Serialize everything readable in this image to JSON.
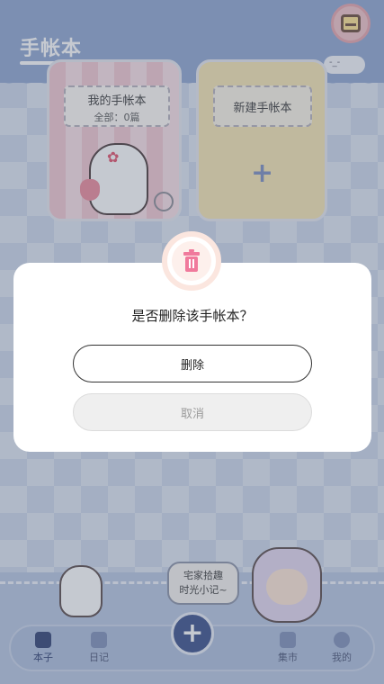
{
  "header": {
    "title": "手帐本"
  },
  "notebooks": [
    {
      "title": "我的手帐本",
      "count_text": "全部：0篇"
    }
  ],
  "new_notebook": {
    "label": "新建手帐本",
    "plus_glyph": "+"
  },
  "dialog": {
    "question": "是否删除该手帐本？",
    "delete_label": "删除",
    "cancel_label": "取消",
    "icon": "trash-icon"
  },
  "decoration": {
    "speech_line1": "宅家拾趣",
    "speech_line2": "时光小记~"
  },
  "tabbar": {
    "items": [
      {
        "label": "本子",
        "icon": "notebook-icon",
        "active": true
      },
      {
        "label": "日记",
        "icon": "calendar-icon",
        "active": false
      },
      {
        "label": "集市",
        "icon": "shop-icon",
        "active": false
      },
      {
        "label": "我的",
        "icon": "profile-icon",
        "active": false
      }
    ],
    "fab_glyph": "+"
  },
  "colors": {
    "header": "#8fa7d2",
    "delete_border": "#333333",
    "cancel_bg": "#efefef",
    "accent": "#3a4f8a"
  }
}
